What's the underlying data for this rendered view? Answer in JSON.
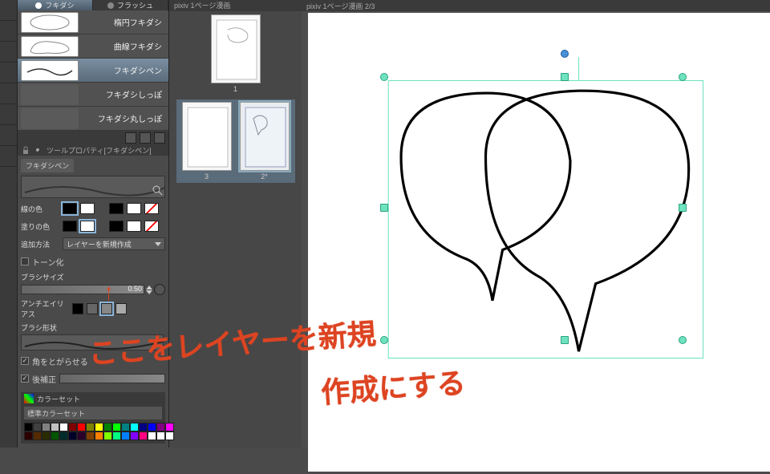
{
  "tabs": {
    "main": "フキダシ",
    "secondary": "フラッシュ"
  },
  "subtools": [
    {
      "label": "楕円フキダシ"
    },
    {
      "label": "曲線フキダシ"
    },
    {
      "label": "フキダシペン"
    },
    {
      "label": "フキダシしっぽ"
    },
    {
      "label": "フキダシ丸しっぽ"
    }
  ],
  "tool_property": {
    "title": "ツールプロパティ[フキダシペン]",
    "mini_tab": "フキダシペン",
    "line_color": "線の色",
    "fill_color": "塗りの色",
    "add_method_label": "追加方法",
    "add_method_value": "レイヤーを新規作成",
    "tone": "トーン化",
    "brush_size_label": "ブラシサイズ",
    "brush_size_value": "0.50",
    "anti_alias": "アンチエイリアス",
    "brush_shape": "ブラシ形状",
    "corner_label": "角をとがらせる",
    "post_correct": "後補正"
  },
  "colorset": {
    "header": "カラーセット",
    "dropdown": "標準カラーセット"
  },
  "pages": {
    "title": "pixiv 1ページ漫画",
    "p1": "1",
    "p3": "3",
    "p2": "2*"
  },
  "canvas": {
    "tab": "pixiv 1ページ漫画  2/3"
  },
  "annotation": {
    "line1": "ここをレイヤーを新規",
    "line2": "作成にする"
  },
  "palette_colors": [
    "#000000",
    "#404040",
    "#808080",
    "#c0c0c0",
    "#ffffff",
    "#800000",
    "#ff0000",
    "#808000",
    "#ffff00",
    "#008000",
    "#00ff00",
    "#008080",
    "#00ffff",
    "#000080",
    "#0000ff",
    "#800080",
    "#ff00ff",
    "#2b0000",
    "#552a00",
    "#2b2b00",
    "#005500",
    "#002b2b",
    "#00002b",
    "#2b002b",
    "#804000",
    "#ff8000",
    "#80ff00",
    "#00ff80",
    "#0080ff",
    "#8000ff",
    "#ff0080",
    "#ffffff",
    "#ffffff",
    "#ffffff"
  ]
}
